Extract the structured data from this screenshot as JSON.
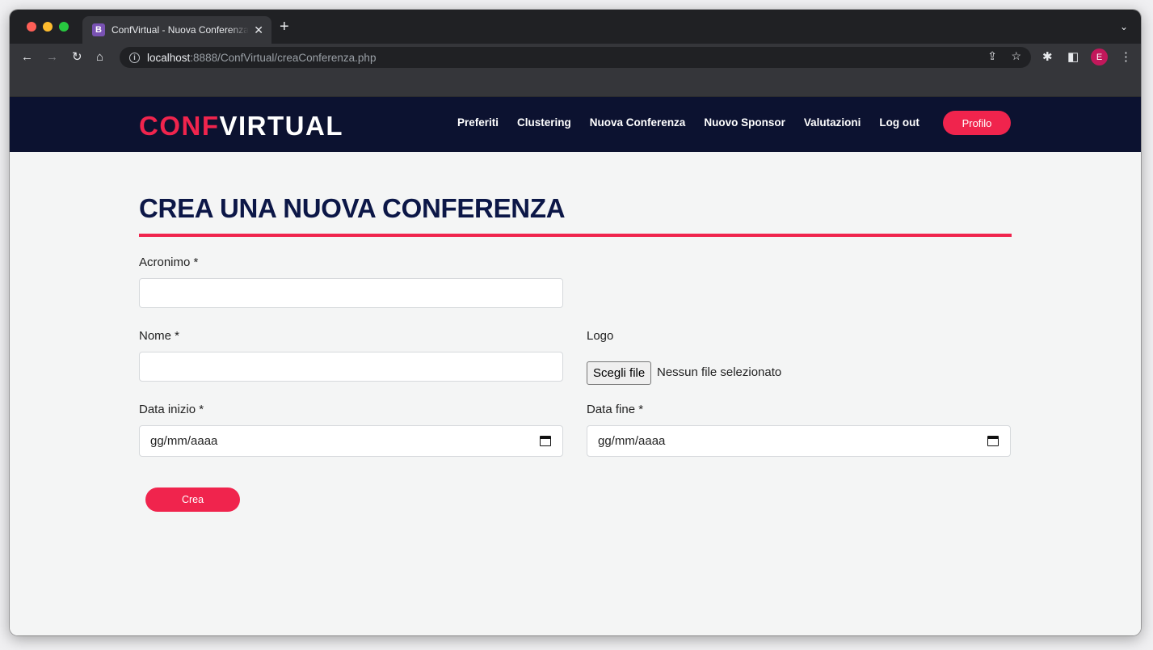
{
  "browser": {
    "tab_title": "ConfVirtual - Nuova Conferenza",
    "tab_favicon_letter": "B",
    "url_host": "localhost",
    "url_rest": ":8888/ConfVirtual/creaConferenza.php",
    "profile_initial": "E"
  },
  "navbar": {
    "brand_part1": "CONF",
    "brand_part2": "VIRTUAL",
    "links": [
      "Preferiti",
      "Clustering",
      "Nuova Conferenza",
      "Nuovo Sponsor",
      "Valutazioni",
      "Log out"
    ],
    "profile_button": "Profilo"
  },
  "form": {
    "title": "CREA UNA NUOVA CONFERENZA",
    "acronimo_label": "Acronimo *",
    "nome_label": "Nome *",
    "logo_label": "Logo",
    "file_button": "Scegli file",
    "file_status": "Nessun file selezionato",
    "data_inizio_label": "Data inizio *",
    "data_inizio_placeholder": "gg/mm/aaaa",
    "data_fine_label": "Data fine *",
    "data_fine_placeholder": "gg/mm/aaaa",
    "submit_label": "Crea"
  },
  "colors": {
    "accent": "#f0244d",
    "navbar_bg": "#0c1230",
    "title": "#0c1747"
  }
}
